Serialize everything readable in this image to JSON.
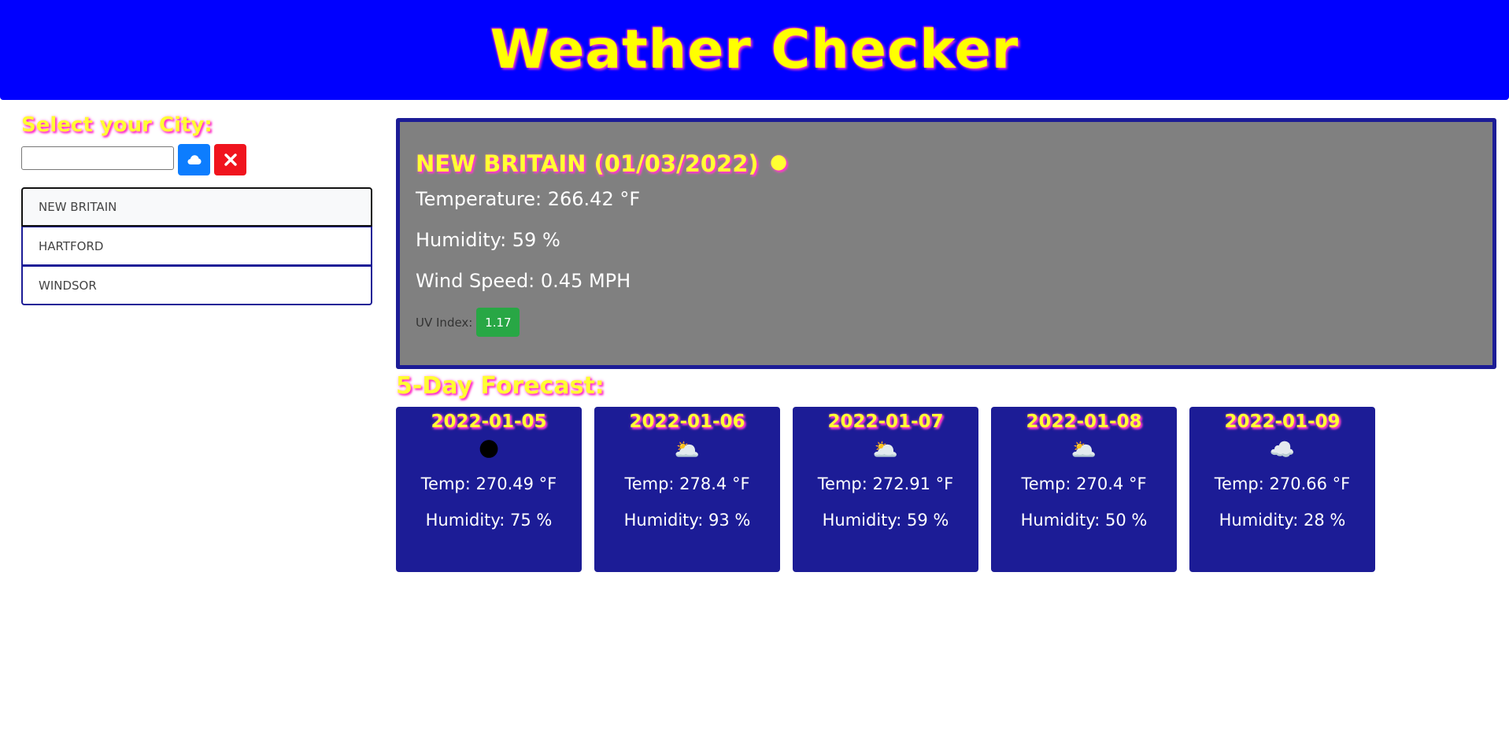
{
  "header": {
    "title": "Weather Checker"
  },
  "sidebar": {
    "label": "Select your City:",
    "search_input_value": "",
    "search_button_icon": "cloud-icon",
    "clear_button_icon": "close-icon",
    "cities": [
      "NEW BRITAIN",
      "HARTFORD",
      "WINDSOR"
    ]
  },
  "current": {
    "heading": "NEW BRITAIN (01/03/2022)",
    "icon": "🌑",
    "icon_name": "night-clear-icon",
    "temperature": "Temperature: 266.42 °F",
    "humidity": "Humidity: 59 %",
    "wind": "Wind Speed: 0.45 MPH",
    "uv_label": "UV Index:",
    "uv_value": "1.17",
    "uv_color": "#28a745"
  },
  "forecast": {
    "title": "5-Day Forecast:",
    "days": [
      {
        "date": "2022-01-05",
        "icon": "🌑",
        "icon_name": "night-clear-icon",
        "temp": "Temp: 270.49 °F",
        "humidity": "Humidity: 75 %"
      },
      {
        "date": "2022-01-06",
        "icon": "🌥️",
        "icon_name": "cloudy-icon",
        "temp": "Temp: 278.4 °F",
        "humidity": "Humidity: 93 %"
      },
      {
        "date": "2022-01-07",
        "icon": "🌥️",
        "icon_name": "cloudy-icon",
        "temp": "Temp: 272.91 °F",
        "humidity": "Humidity: 59 %"
      },
      {
        "date": "2022-01-08",
        "icon": "🌥️",
        "icon_name": "cloudy-icon",
        "temp": "Temp: 270.4 °F",
        "humidity": "Humidity: 50 %"
      },
      {
        "date": "2022-01-09",
        "icon": "☁️",
        "icon_name": "cloud-icon",
        "temp": "Temp: 270.66 °F",
        "humidity": "Humidity: 28 %"
      }
    ]
  },
  "colors": {
    "header_bg": "#0000ff",
    "title_yellow": "#ffff00",
    "card_bg": "#1c1c96",
    "current_bg": "#808080",
    "search_button": "#0d7dfe",
    "clear_button": "#f0141e"
  }
}
